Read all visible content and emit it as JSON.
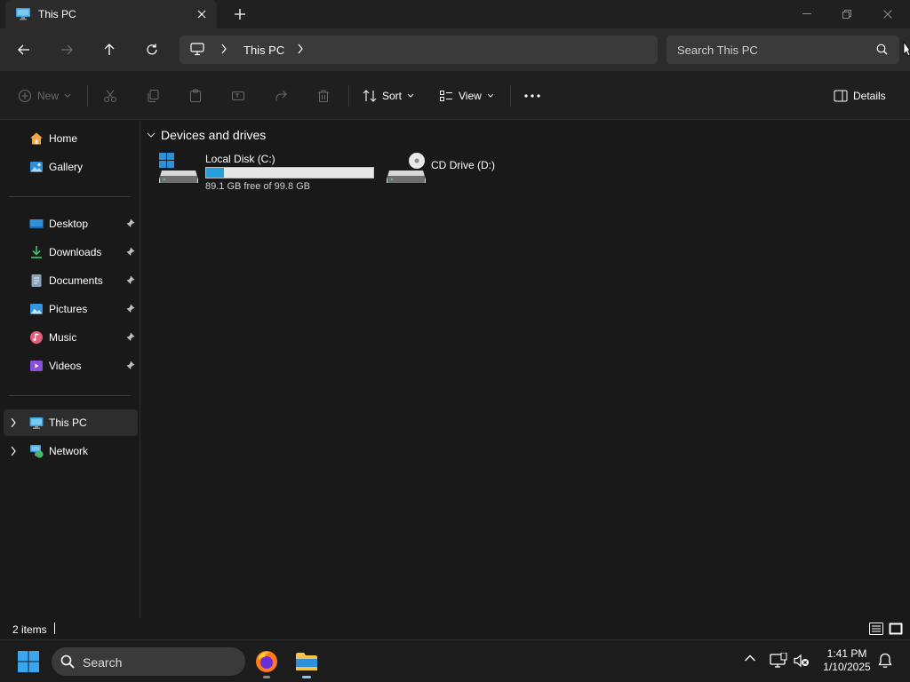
{
  "window": {
    "tab_title": "This PC"
  },
  "address": {
    "crumb": "This PC"
  },
  "search": {
    "placeholder": "Search This PC"
  },
  "commands": {
    "new": "New",
    "sort": "Sort",
    "view": "View",
    "details": "Details"
  },
  "sidebar": {
    "items": [
      {
        "label": "Home",
        "icon": "home-icon"
      },
      {
        "label": "Gallery",
        "icon": "gallery-icon"
      },
      {
        "label": "Desktop",
        "icon": "desktop-icon",
        "pinned": true
      },
      {
        "label": "Downloads",
        "icon": "downloads-icon",
        "pinned": true
      },
      {
        "label": "Documents",
        "icon": "documents-icon",
        "pinned": true
      },
      {
        "label": "Pictures",
        "icon": "pictures-icon",
        "pinned": true
      },
      {
        "label": "Music",
        "icon": "music-icon",
        "pinned": true
      },
      {
        "label": "Videos",
        "icon": "videos-icon",
        "pinned": true
      },
      {
        "label": "This PC",
        "icon": "this-pc-icon",
        "selected": true
      },
      {
        "label": "Network",
        "icon": "network-icon"
      }
    ]
  },
  "content": {
    "group_title": "Devices and drives",
    "drives": [
      {
        "name": "Local Disk (C:)",
        "free_text": "89.1 GB free of 99.8 GB",
        "used_fraction": 0.107
      },
      {
        "name": "CD Drive (D:)"
      }
    ]
  },
  "status": {
    "item_count": "2 items"
  },
  "taskbar": {
    "search_label": "Search",
    "time": "1:41 PM",
    "date": "1/10/2025"
  },
  "colors": {
    "accent": "#26a0da",
    "folder_yellow": "#f6c244"
  }
}
